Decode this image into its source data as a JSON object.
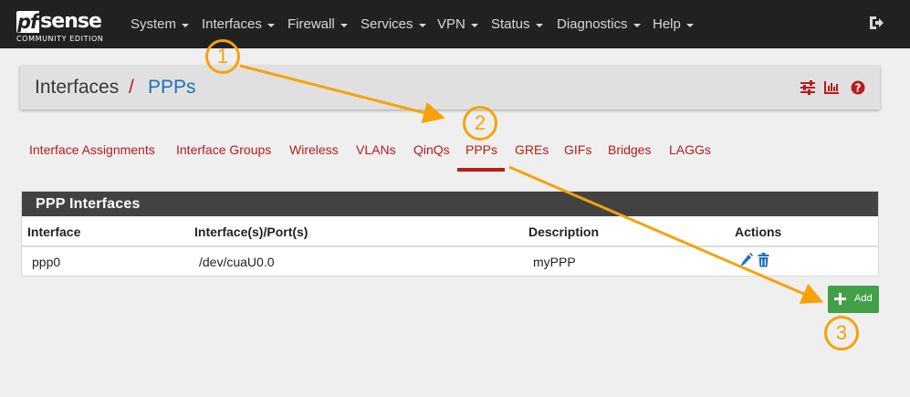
{
  "navbar": {
    "logo": {
      "main_pf": "pf",
      "main_sense": "sense",
      "sub": "COMMUNITY EDITION"
    },
    "menus": [
      "System",
      "Interfaces",
      "Firewall",
      "Services",
      "VPN",
      "Status",
      "Diagnostics",
      "Help"
    ],
    "logout_icon": "sign-out-icon"
  },
  "header": {
    "breadcrumb_root": "Interfaces",
    "separator": "/",
    "breadcrumb_current": "PPPs",
    "icons": [
      "sliders-icon",
      "bar-chart-icon",
      "question-circle-icon"
    ]
  },
  "tabs": {
    "items": [
      "Interface Assignments",
      "Interface Groups",
      "Wireless",
      "VLANs",
      "QinQs",
      "PPPs",
      "GREs",
      "GIFs",
      "Bridges",
      "LAGGs"
    ],
    "active": "PPPs"
  },
  "panel": {
    "title": "PPP Interfaces",
    "columns": [
      "Interface",
      "Interface(s)/Port(s)",
      "Description",
      "Actions"
    ],
    "rows": [
      {
        "interface": "ppp0",
        "ports": "/dev/cuaU0.0",
        "description": "myPPP",
        "actions": [
          "pencil-icon",
          "trash-icon"
        ]
      }
    ]
  },
  "add_button": {
    "label": "Add",
    "icon": "plus-icon"
  },
  "annotations": [
    "1",
    "2",
    "3"
  ],
  "colors": {
    "navbar": "#212121",
    "accent_red": "#b71c1c",
    "link_blue": "#1e72b8",
    "add_green": "#43a047",
    "annotation_orange": "#f5a30a"
  }
}
